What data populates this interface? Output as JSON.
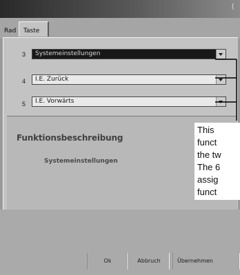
{
  "window": {
    "title_glyph": "("
  },
  "tabs": [
    {
      "label": "Rad"
    },
    {
      "label": "Taste"
    }
  ],
  "button_rows": [
    {
      "number": "3",
      "value": "Systemeinstellungen",
      "highlighted": true
    },
    {
      "number": "4",
      "value": "I.E. Zurück",
      "highlighted": false
    },
    {
      "number": "5",
      "value": "I.E. Vorwärts",
      "highlighted": false
    }
  ],
  "description_group": {
    "title": "Funktionsbeschreibung",
    "text": "Systemeinstellungen"
  },
  "buttons": {
    "ok": "Ok",
    "cancel": "Abbruch",
    "apply": "Übernehmen"
  },
  "callout": {
    "lines": [
      "This",
      "funct",
      "the tw",
      "The 6",
      "assig",
      "funct"
    ]
  }
}
